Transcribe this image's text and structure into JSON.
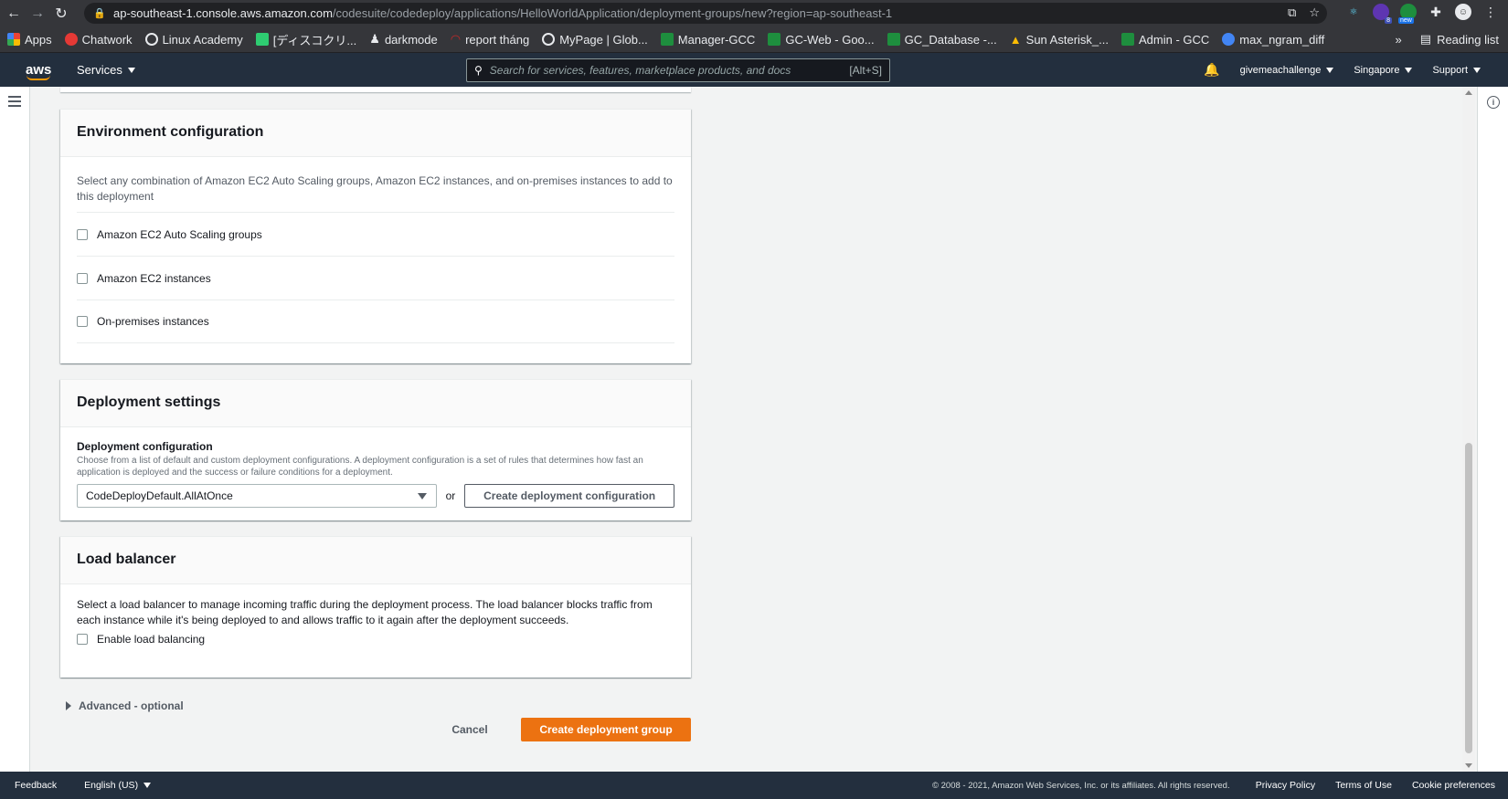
{
  "browser": {
    "url_host": "ap-southeast-1.console.aws.amazon.com",
    "url_path": "/codesuite/codedeploy/applications/HelloWorldApplication/deployment-groups/new?region=ap-southeast-1",
    "reading_list": "Reading list",
    "ext_badges": [
      "8",
      "new"
    ],
    "bookmarks": [
      {
        "label": "Apps",
        "color": "#ea4335"
      },
      {
        "label": "Chatwork",
        "color": "#e53935"
      },
      {
        "label": "Linux Academy",
        "color": "#e8eaed"
      },
      {
        "label": "[ディスコクリ...",
        "color": "#2ecc71"
      },
      {
        "label": "darkmode",
        "color": "#e8eaed"
      },
      {
        "label": "report tháng",
        "color": "#c62828"
      },
      {
        "label": "MyPage | Glob...",
        "color": "#e8eaed"
      },
      {
        "label": "Manager-GCC",
        "color": "#1e8e3e"
      },
      {
        "label": "GC-Web - Goo...",
        "color": "#1e8e3e"
      },
      {
        "label": "GC_Database -...",
        "color": "#1e8e3e"
      },
      {
        "label": "Sun Asterisk_...",
        "color": "#fbbc04"
      },
      {
        "label": "Admin - GCC",
        "color": "#1e8e3e"
      },
      {
        "label": "max_ngram_diff",
        "color": "#4285f4"
      }
    ],
    "more": "»"
  },
  "aws": {
    "logo": "aws",
    "services": "Services",
    "search_placeholder": "Search for services, features, marketplace products, and docs",
    "search_shortcut": "[Alt+S]",
    "account": "givemeachallenge",
    "region": "Singapore",
    "support": "Support"
  },
  "env": {
    "title": "Environment configuration",
    "description": "Select any combination of Amazon EC2 Auto Scaling groups, Amazon EC2 instances, and on-premises instances to add to this deployment",
    "options": [
      "Amazon EC2 Auto Scaling groups",
      "Amazon EC2 instances",
      "On-premises instances"
    ]
  },
  "deploy": {
    "title": "Deployment settings",
    "config_label": "Deployment configuration",
    "config_desc": "Choose from a list of default and custom deployment configurations. A deployment configuration is a set of rules that determines how fast an application is deployed and the success or failure conditions for a deployment.",
    "selected": "CodeDeployDefault.AllAtOnce",
    "or": "or",
    "create_btn": "Create deployment configuration"
  },
  "lb": {
    "title": "Load balancer",
    "description": "Select a load balancer to manage incoming traffic during the deployment process. The load balancer blocks traffic from each instance while it's being deployed to and allows traffic to it again after the deployment succeeds.",
    "enable": "Enable load balancing"
  },
  "advanced": "Advanced - optional",
  "actions": {
    "cancel": "Cancel",
    "create": "Create deployment group"
  },
  "footer": {
    "feedback": "Feedback",
    "language": "English (US)",
    "copyright": "© 2008 - 2021, Amazon Web Services, Inc. or its affiliates. All rights reserved.",
    "privacy": "Privacy Policy",
    "terms": "Terms of Use",
    "cookies": "Cookie preferences"
  }
}
